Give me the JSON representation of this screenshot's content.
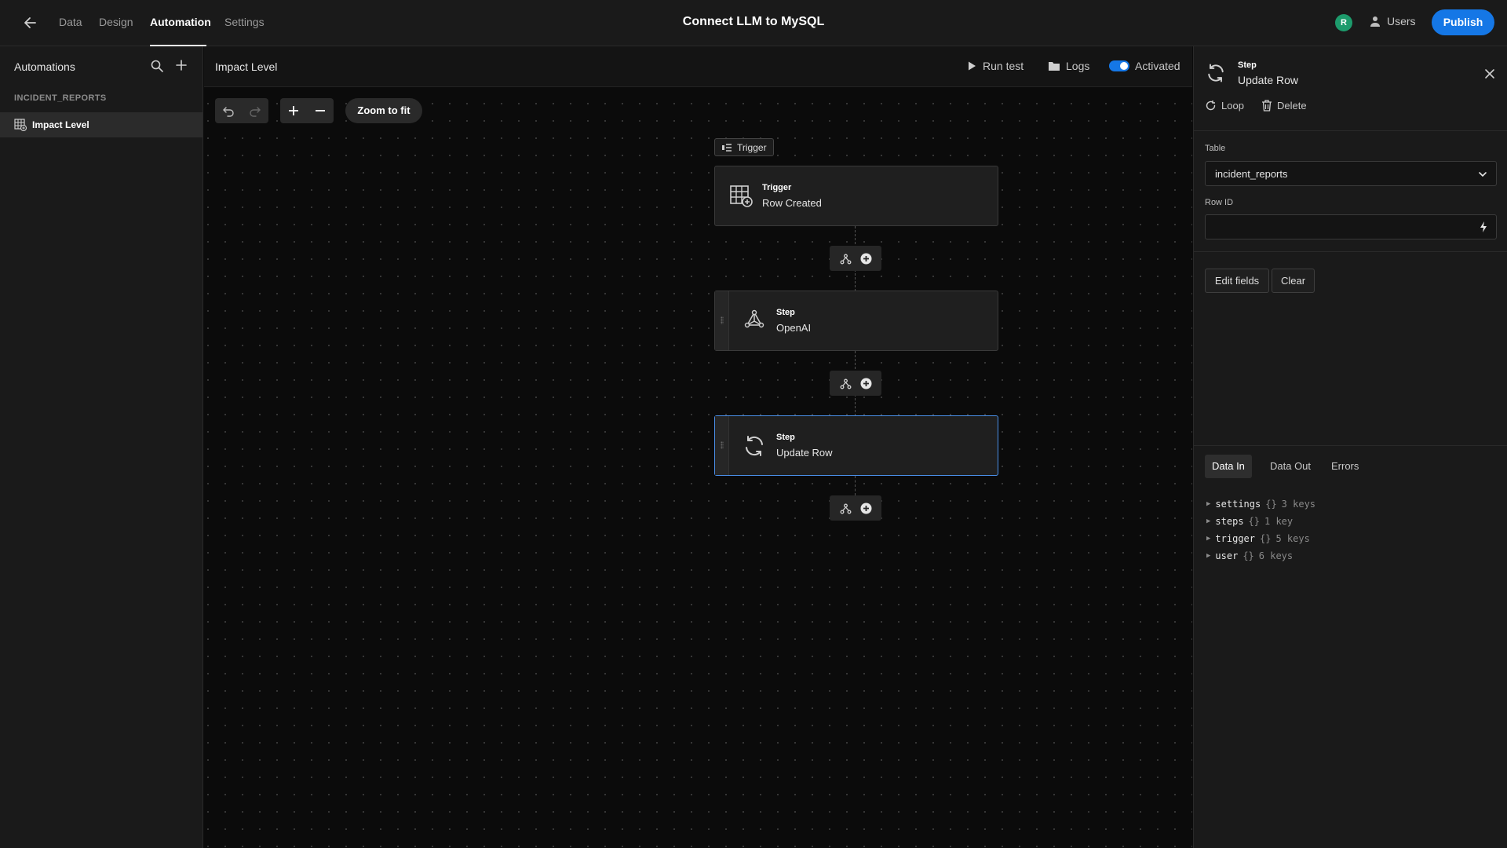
{
  "topbar": {
    "nav": [
      "Data",
      "Design",
      "Automation",
      "Settings"
    ],
    "title": "Connect LLM to MySQL",
    "avatar_initial": "R",
    "users_label": "Users",
    "publish_label": "Publish"
  },
  "sidebar": {
    "title": "Automations",
    "group": "INCIDENT_REPORTS",
    "item": "Impact Level"
  },
  "canvas": {
    "title": "Impact Level",
    "run_test": "Run test",
    "logs": "Logs",
    "activated_label": "Activated",
    "activated": true,
    "zoom_fit": "Zoom to fit",
    "trigger_tag": "Trigger",
    "nodes": [
      {
        "kind": "Trigger",
        "name": "Row Created",
        "icon": "table-add-icon"
      },
      {
        "kind": "Step",
        "name": "OpenAI",
        "icon": "openai-icon"
      },
      {
        "kind": "Step",
        "name": "Update Row",
        "icon": "refresh-icon"
      }
    ]
  },
  "panel": {
    "kind": "Step",
    "name": "Update Row",
    "loop": "Loop",
    "delete": "Delete",
    "table_label": "Table",
    "table_value": "incident_reports",
    "rowid_label": "Row ID",
    "rowid_value": "",
    "edit_fields": "Edit fields",
    "clear": "Clear",
    "tabs": [
      "Data In",
      "Data Out",
      "Errors"
    ],
    "active_tab": "Data In",
    "tree": [
      {
        "key": "settings",
        "braces": "{}",
        "count": "3 keys"
      },
      {
        "key": "steps",
        "braces": "{}",
        "count": "1 key"
      },
      {
        "key": "trigger",
        "braces": "{}",
        "count": "5 keys"
      },
      {
        "key": "user",
        "braces": "{}",
        "count": "6 keys"
      }
    ]
  },
  "colors": {
    "accent": "#1577e6",
    "avatar": "#1d9b6c",
    "selected_border": "#4a8fe8"
  }
}
